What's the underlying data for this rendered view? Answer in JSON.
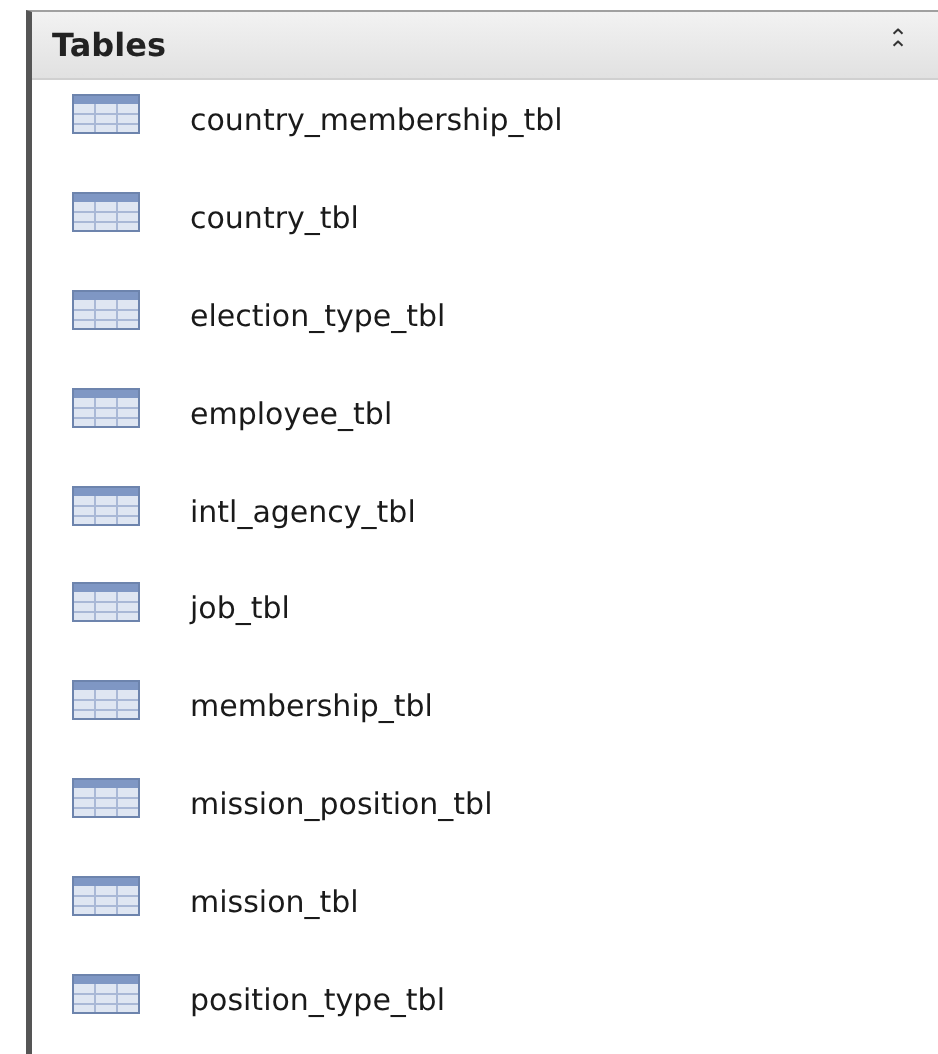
{
  "panel": {
    "title": "Tables",
    "collapse_glyph": "⌃",
    "expanded": true
  },
  "items": [
    {
      "label": "country_membership_tbl"
    },
    {
      "label": "country_tbl"
    },
    {
      "label": "election_type_tbl"
    },
    {
      "label": "employee_tbl"
    },
    {
      "label": "intl_agency_tbl"
    },
    {
      "label": "job_tbl"
    },
    {
      "label": "membership_tbl"
    },
    {
      "label": "mission_position_tbl"
    },
    {
      "label": "mission_tbl"
    },
    {
      "label": "position_type_tbl"
    }
  ]
}
